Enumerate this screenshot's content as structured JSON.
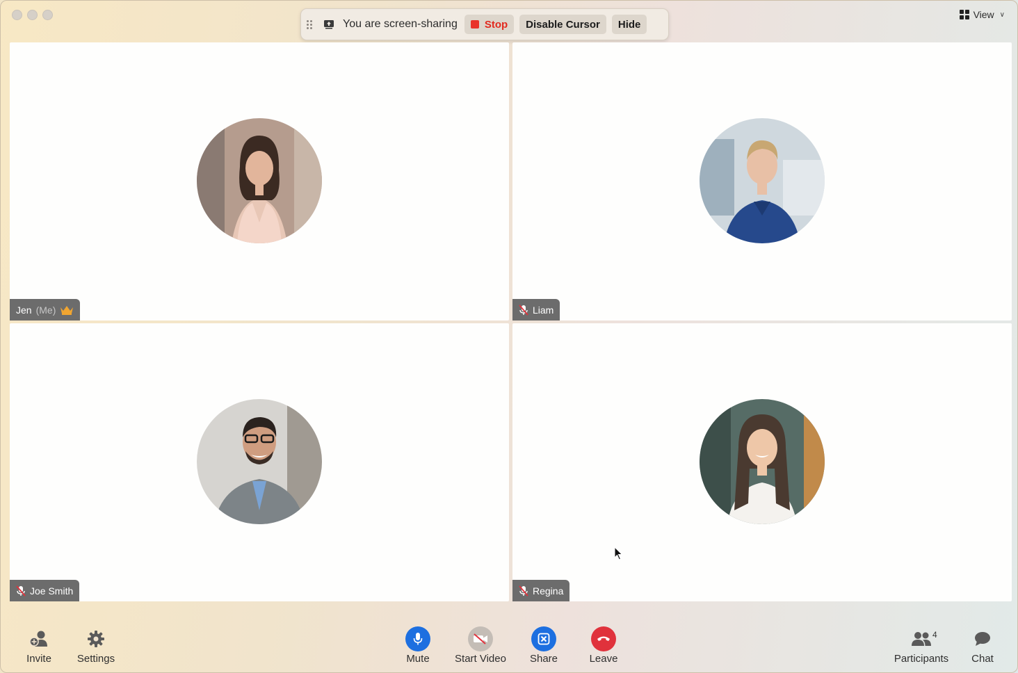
{
  "window": {
    "view_label": "View"
  },
  "share_bar": {
    "status_text": "You are screen-sharing",
    "stop_label": "Stop",
    "disable_cursor_label": "Disable Cursor",
    "hide_label": "Hide"
  },
  "tiles": [
    {
      "name": "Jen",
      "suffix": "(Me)",
      "host": true,
      "muted": false
    },
    {
      "name": "Liam",
      "muted": true
    },
    {
      "name": "Joe Smith",
      "muted": true
    },
    {
      "name": "Regina",
      "muted": true
    }
  ],
  "toolbar": {
    "invite": "Invite",
    "settings": "Settings",
    "mute": "Mute",
    "start_video": "Start Video",
    "share": "Share",
    "leave": "Leave",
    "participants": "Participants",
    "participants_count": "4",
    "chat": "Chat"
  },
  "colors": {
    "accent_blue": "#1d6fe0",
    "leave_red": "#e0323c",
    "stop_red": "#e22a1f",
    "nametag_bg": "#6c6c6c",
    "host_crown": "#f0a531"
  },
  "icons": [
    "grid-icon",
    "drag-handle-icon",
    "share-screen-icon",
    "stop-icon",
    "crown-icon",
    "mic-muted-icon",
    "add-user-icon",
    "gear-icon",
    "mic-icon",
    "video-off-icon",
    "share-arrow-icon",
    "phone-hangup-icon",
    "participants-icon",
    "chat-bubble-icon",
    "mouse-cursor-icon"
  ]
}
